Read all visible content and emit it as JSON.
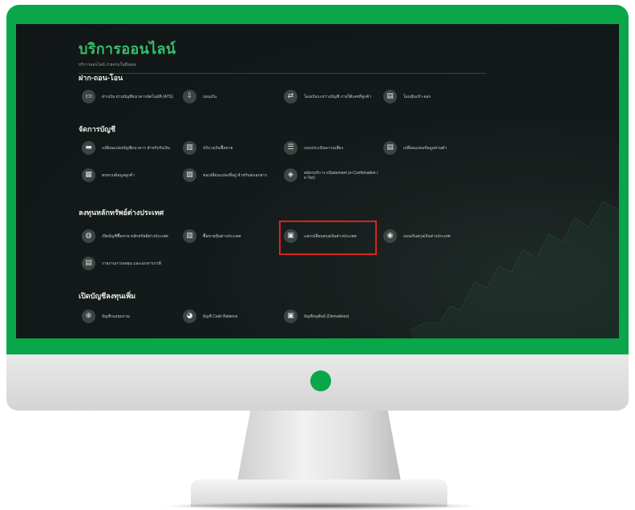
{
  "page": {
    "title": "บริการออนไลน์",
    "subtitle": "บริการออนไลน์ ง่ายครบในมือคุณ"
  },
  "sections": [
    {
      "title": "ฝาก-ถอน-โอน",
      "items": [
        {
          "icon": "card-icon",
          "glyph": "▭",
          "label": "ฝากเงิน ผ่านบัญชีธนาคารอัตโนมัติ (ATS)"
        },
        {
          "icon": "withdraw-icon",
          "glyph": "⇩",
          "label": "ถอนเงิน"
        },
        {
          "icon": "transfer-icon",
          "glyph": "⇄",
          "label": "โอนเงินระหว่างบัญชี ภายใต้เลขที่ลูกค้า"
        },
        {
          "icon": "document-icon",
          "glyph": "▤",
          "label": "โอนหุ้นเข้า-ออก"
        }
      ]
    },
    {
      "title": "จัดการบัญชี",
      "items": [
        {
          "icon": "bank-card-icon",
          "glyph": "▬",
          "label": "เปลี่ยนแปลงบัญชีธนาคาร สำหรับรับเงิน"
        },
        {
          "icon": "chart-icon",
          "glyph": "▥",
          "label": "ปรับวงเงินซื้อขาย"
        },
        {
          "icon": "list-icon",
          "glyph": "☰",
          "label": "แบบประเมินความเสี่ยง"
        },
        {
          "icon": "file-icon",
          "glyph": "▤",
          "label": "เปลี่ยนแปลงข้อมูลส่วนตัว"
        },
        {
          "icon": "form-icon",
          "glyph": "▦",
          "label": "ทบทวนข้อมูลลูกค้า"
        },
        {
          "icon": "doc-check-icon",
          "glyph": "▧",
          "label": "ขอเปลี่ยนแปลงที่อยู่ สำหรับส่งเอกสาร"
        },
        {
          "icon": "shield-icon",
          "glyph": "◈",
          "label": "สมัครบริการ eStatement (e-Confirmation / e-Tax)"
        }
      ]
    },
    {
      "title": "ลงทุนหลักทรัพย์ต่างประเทศ",
      "items": [
        {
          "icon": "globe-icon",
          "glyph": "◍",
          "label": "เปิดบัญชีซื้อขาย หลักทรัพย์ต่างประเทศ"
        },
        {
          "icon": "bar-chart-icon",
          "glyph": "▥",
          "label": "ซื้อขายหุ้นต่างประเทศ"
        },
        {
          "icon": "exchange-icon",
          "glyph": "▣",
          "label": "แลกเปลี่ยนสกุลเงินต่างประเทศ"
        },
        {
          "icon": "wallet-icon",
          "glyph": "◉",
          "label": "ถอนเงินสกุลเงินต่างประเทศ"
        },
        {
          "icon": "report-icon",
          "glyph": "▤",
          "label": "รายงานการลงทุน และเอกสารภาษี"
        }
      ]
    },
    {
      "title": "เปิดบัญชีลงทุนเพิ่ม",
      "items": [
        {
          "icon": "add-icon",
          "glyph": "⊕",
          "label": "บัญชีกองทุนรวม"
        },
        {
          "icon": "cash-icon",
          "glyph": "◕",
          "label": "บัญชี Cash Balance"
        },
        {
          "icon": "derivatives-icon",
          "glyph": "▣",
          "label": "บัญชีอนุพันธ์ (Derivatives)"
        }
      ]
    }
  ],
  "highlight_color": "#e02020",
  "brand_color": "#0aa64a"
}
